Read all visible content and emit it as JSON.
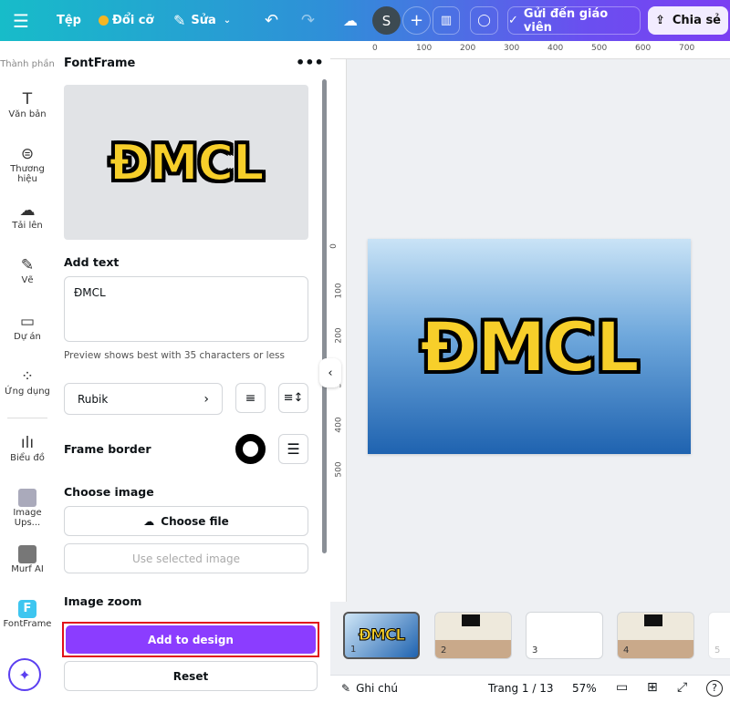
{
  "topbar": {
    "file": "Tệp",
    "resize": "Đổi cỡ",
    "edit": "Sửa",
    "avatar": "S",
    "send": "Gửi đến giáo viên",
    "share": "Chia sẻ"
  },
  "rail": {
    "items": [
      {
        "label": "Thành phần",
        "icon": "shapes-icon"
      },
      {
        "label": "Văn bản",
        "icon": "text-icon"
      },
      {
        "label": "Thương hiệu",
        "icon": "brand-icon"
      },
      {
        "label": "Tải lên",
        "icon": "upload-icon"
      },
      {
        "label": "Vẽ",
        "icon": "draw-icon"
      },
      {
        "label": "Dự án",
        "icon": "folder-icon"
      },
      {
        "label": "Ứng dụng",
        "icon": "apps-icon"
      },
      {
        "label": "Biểu đồ",
        "icon": "chart-icon"
      },
      {
        "label": "Image Ups...",
        "icon": "image-upscaler-icon"
      },
      {
        "label": "Murf AI",
        "icon": "murf-icon"
      },
      {
        "label": "FontFrame",
        "icon": "fontframe-icon"
      }
    ]
  },
  "panel": {
    "title": "FontFrame",
    "preview_text": "ĐMCL",
    "add_text_label": "Add text",
    "text_value": "ĐMCL",
    "hint": "Preview shows best with 35 characters or less",
    "font": "Rubik",
    "frame_border": "Frame border",
    "choose_image": "Choose image",
    "choose_file": "Choose file",
    "use_selected": "Use selected image",
    "image_zoom": "Image zoom",
    "add_to_design": "Add to design",
    "reset": "Reset"
  },
  "ruler": {
    "top": [
      "0",
      "100",
      "200",
      "300",
      "400",
      "500",
      "600",
      "700"
    ],
    "left": [
      "0",
      "100",
      "200",
      "300",
      "400",
      "500"
    ]
  },
  "design": {
    "text": "ĐMCL"
  },
  "pages": [
    {
      "n": "1"
    },
    {
      "n": "2"
    },
    {
      "n": "3"
    },
    {
      "n": "4"
    },
    {
      "n": "5"
    }
  ],
  "bottom": {
    "notes": "Ghi chú",
    "page": "Trang 1 / 13",
    "zoom": "57%"
  },
  "colors": {
    "accent": "#8b3dff",
    "highlight": "#e0101a",
    "logo_fill": "#f7cf2a"
  }
}
